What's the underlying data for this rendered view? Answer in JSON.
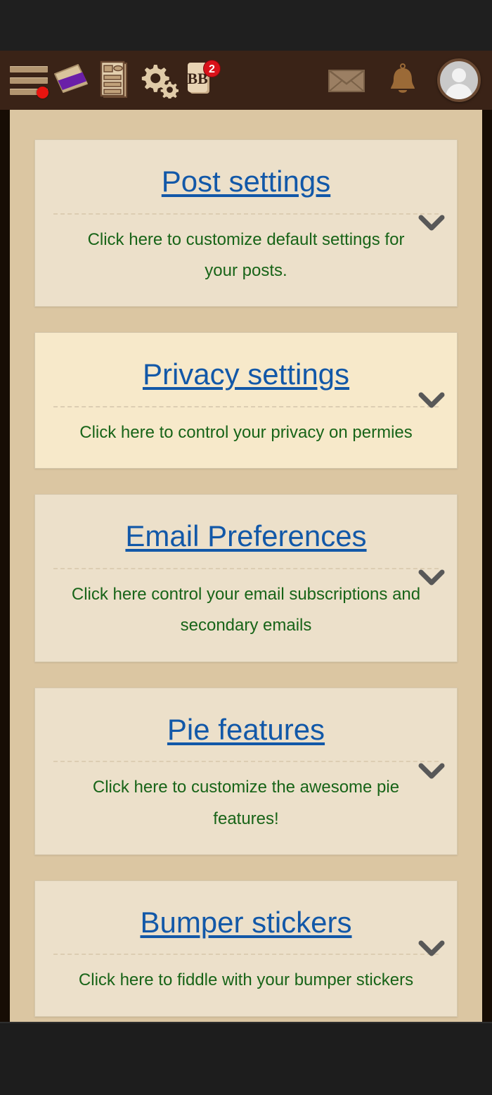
{
  "appbar": {
    "menu": {
      "icon": "hamburger-menu-icon",
      "has_notification_dot": true
    },
    "items": [
      {
        "icon": "pie-slice-icon",
        "label": "Pie"
      },
      {
        "icon": "newspaper-article-icon",
        "label": "Articles"
      },
      {
        "icon": "gears-settings-icon",
        "label": "Settings"
      },
      {
        "icon": "bb-card-icon",
        "label": "BB",
        "badge": "2"
      }
    ],
    "right_items": [
      {
        "icon": "envelope-mail-icon",
        "label": "Messages"
      },
      {
        "icon": "bell-notifications-icon",
        "label": "Notifications"
      },
      {
        "icon": "user-avatar-icon",
        "label": "Account"
      }
    ]
  },
  "colors": {
    "appbar_bg": "#3a2317",
    "page_bg": "#dbc6a2",
    "card_bg": "#ece0ca",
    "card_bg_hover": "#f7e9ca",
    "link": "#1258a8",
    "description": "#186418",
    "badge": "#d9121a",
    "menu_dot": "#e8140f",
    "chevron": "#585858"
  },
  "settings_cards": [
    {
      "title": "Post settings",
      "description": "Click here to customize default settings for your posts.",
      "chevron": "chevron-down-icon",
      "hovered": false
    },
    {
      "title": "Privacy settings",
      "description": "Click here to control your privacy on permies",
      "chevron": "chevron-down-icon",
      "hovered": true
    },
    {
      "title": "Email Preferences",
      "description": "Click here control your email subscriptions and secondary emails",
      "chevron": "chevron-down-icon",
      "hovered": false
    },
    {
      "title": "Pie features",
      "description": "Click here to customize the awesome pie features!",
      "chevron": "chevron-down-icon",
      "hovered": false
    },
    {
      "title": "Bumper stickers",
      "description": "Click here to fiddle with your bumper stickers",
      "chevron": "chevron-down-icon",
      "hovered": false
    }
  ]
}
